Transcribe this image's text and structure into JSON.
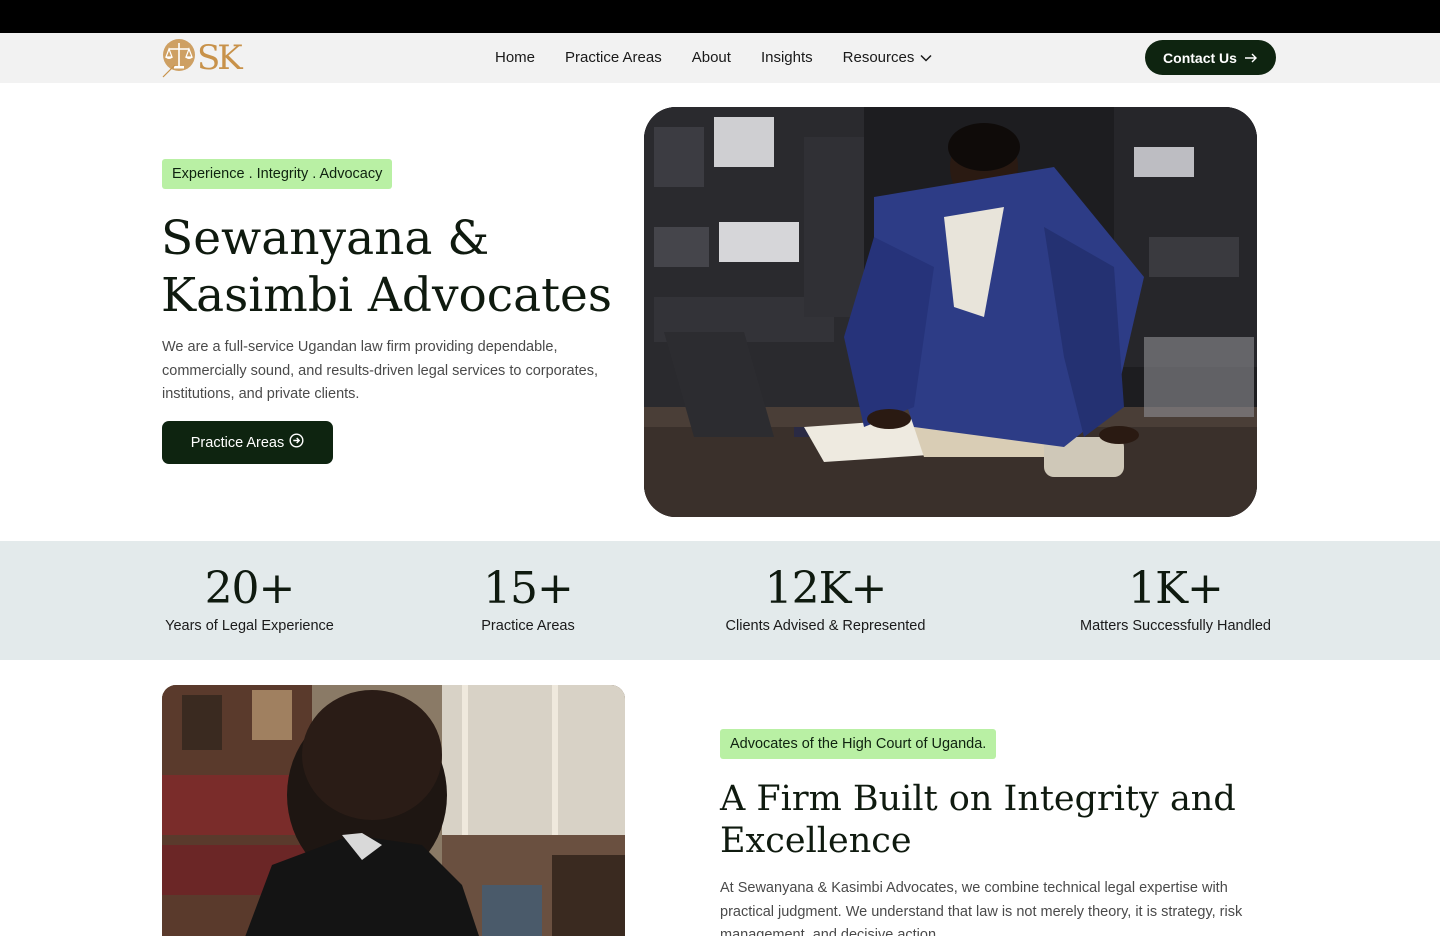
{
  "nav": {
    "logo_text": "SK",
    "items": [
      {
        "label": "Home"
      },
      {
        "label": "Practice Areas"
      },
      {
        "label": "About"
      },
      {
        "label": "Insights"
      },
      {
        "label": "Resources"
      }
    ],
    "contact_label": "Contact Us"
  },
  "hero": {
    "badge": "Experience . Integrity . Advocacy",
    "title_line1": "Sewanyana &",
    "title_line2": "Kasimbi Advocates",
    "description": "We are a full-service Ugandan law firm providing dependable, commercially sound, and results-driven legal services to corporates, institutions, and private clients.",
    "button_label": "Practice Areas"
  },
  "stats": [
    {
      "number": "20+",
      "label": "Years of Legal Experience"
    },
    {
      "number": "15+",
      "label": "Practice Areas"
    },
    {
      "number": "12K+",
      "label": "Clients Advised & Represented"
    },
    {
      "number": "1K+",
      "label": "Matters Successfully Handled"
    }
  ],
  "about": {
    "badge": "Advocates of the High Court of Uganda.",
    "title_line1": "A Firm Built on Integrity and",
    "title_line2": "Excellence",
    "description": "At Sewanyana & Kasimbi Advocates, we combine technical legal expertise with practical judgment. We understand that law is not merely theory, it is strategy, risk management, and decisive action."
  },
  "colors": {
    "accent_dark_green": "#0e2410",
    "badge_green": "#b9f0a4",
    "stats_band": "#e3eaeb",
    "logo_gold": "#c8924a"
  },
  "icons": {
    "logo": "scales-of-justice-icon",
    "resources_dropdown": "chevron-down-icon",
    "contact_arrow": "arrow-right-icon",
    "practice_button": "circle-arrow-right-icon"
  }
}
